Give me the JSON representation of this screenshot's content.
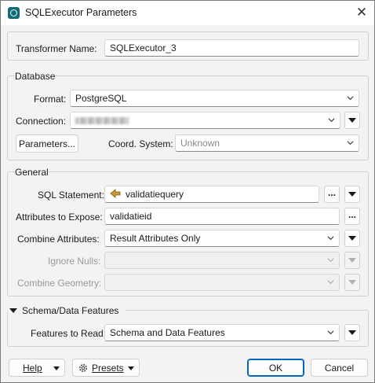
{
  "window": {
    "title": "SQLExecutor Parameters",
    "close_glyph": "✕"
  },
  "transformer": {
    "label": "Transformer Name:",
    "value": "SQLExecutor_3"
  },
  "database": {
    "group_label": "Database",
    "format_label": "Format:",
    "format_value": "PostgreSQL",
    "connection_label": "Connection:",
    "connection_value": "",
    "parameters_button": "Parameters...",
    "coord_label": "Coord. System:",
    "coord_value": "Unknown"
  },
  "general": {
    "group_label": "General",
    "sql_label": "SQL Statement:",
    "sql_value": "validatiequery",
    "attrs_label": "Attributes to Expose:",
    "attrs_value": "validatieid",
    "combine_label": "Combine Attributes:",
    "combine_value": "Result Attributes Only",
    "ignore_nulls_label": "Ignore Nulls:",
    "combine_geom_label": "Combine Geometry:"
  },
  "schema": {
    "group_label": "Schema/Data Features",
    "features_label": "Features to Read:",
    "features_value": "Schema and Data Features"
  },
  "footer": {
    "help": "Help",
    "presets": "Presets",
    "ok": "OK",
    "cancel": "Cancel"
  },
  "icons": {
    "app": "fme-app-icon",
    "close": "close-icon",
    "chevron": "chevron-down-icon",
    "menu": "triangle-down-icon",
    "sql": "sql-arrow-icon",
    "presets": "gear-icon"
  },
  "colors": {
    "accent": "#0067c0",
    "window_bg": "#f3f3f3",
    "sql_icon": "#c79a3a"
  }
}
